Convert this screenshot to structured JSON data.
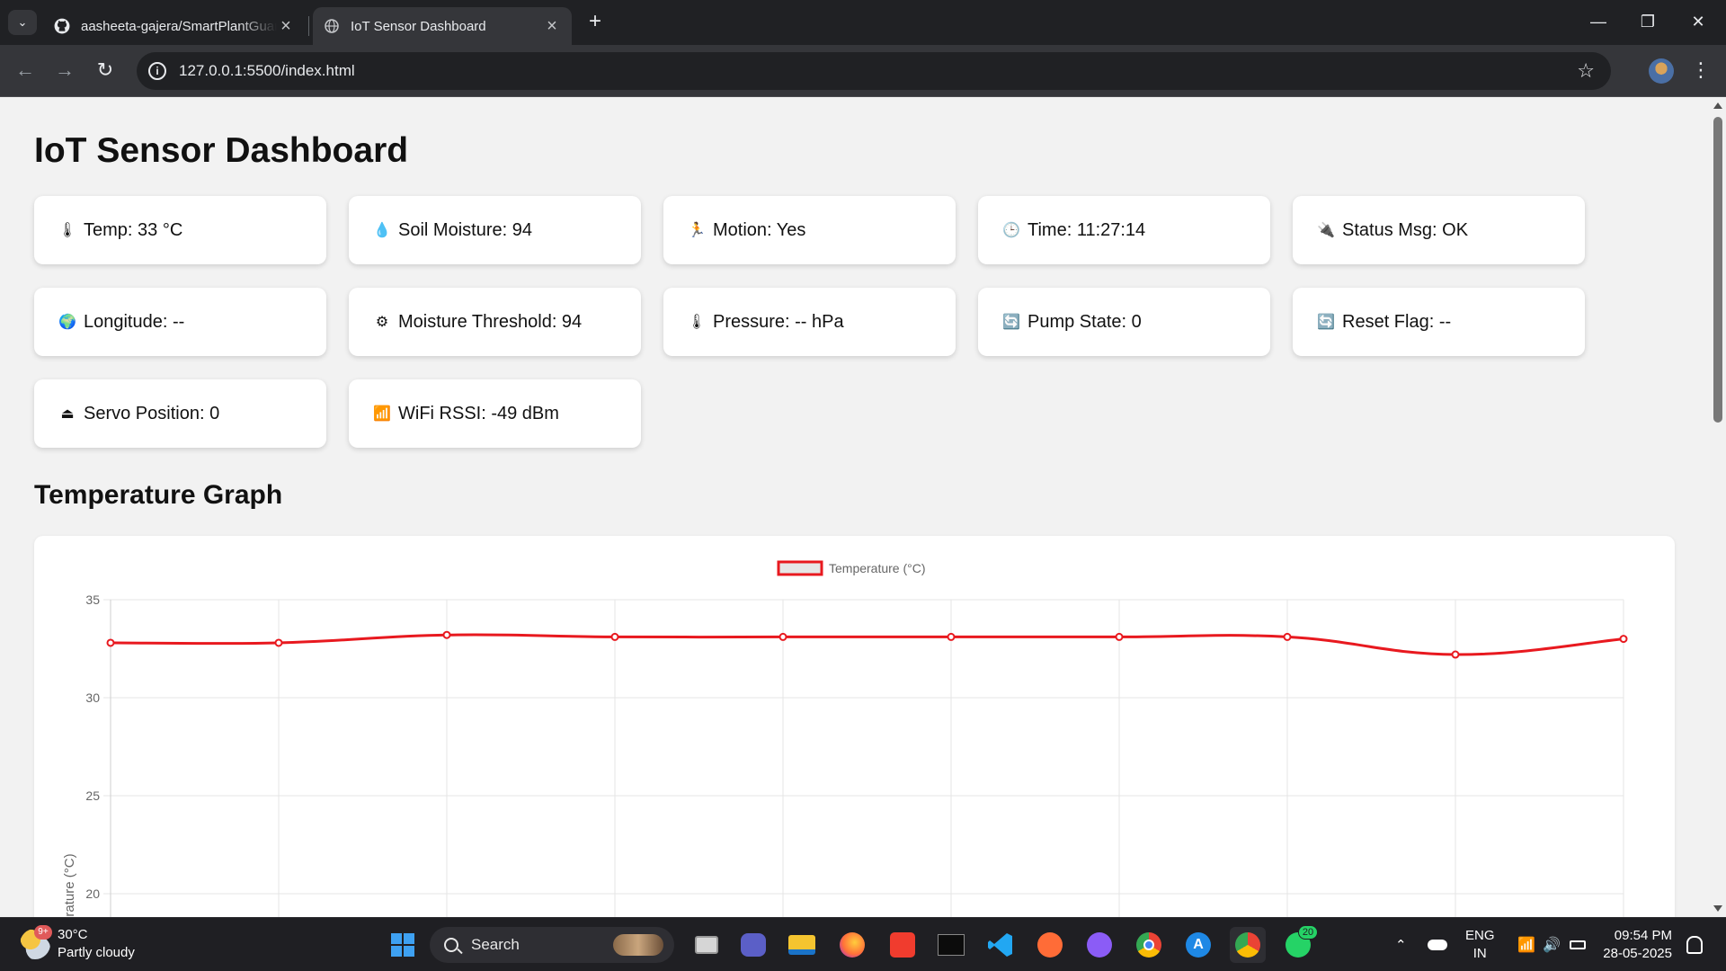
{
  "browser": {
    "tabs": [
      {
        "title": "aasheeta-gajera/SmartPlantGuard",
        "favicon": "github-icon",
        "active": false
      },
      {
        "title": "IoT Sensor Dashboard",
        "favicon": "globe-icon",
        "active": true
      }
    ],
    "url": "127.0.0.1:5500/index.html"
  },
  "page": {
    "title": "IoT Sensor Dashboard",
    "cards": [
      {
        "icon": "thermometer-icon",
        "glyph": "🌡",
        "label": "Temp: 33 °C"
      },
      {
        "icon": "droplet-icon",
        "glyph": "💧",
        "label": "Soil Moisture: 94"
      },
      {
        "icon": "running-person-icon",
        "glyph": "🏃",
        "label": "Motion: Yes"
      },
      {
        "icon": "clock-icon",
        "glyph": "🕒",
        "label": "Time: 11:27:14"
      },
      {
        "icon": "plug-icon",
        "glyph": "🔌",
        "label": "Status Msg: OK"
      },
      {
        "icon": "globe-icon",
        "glyph": "🌍",
        "label": "Longitude: --"
      },
      {
        "icon": "gear-icon",
        "glyph": "⚙",
        "label": "Moisture Threshold: 94"
      },
      {
        "icon": "thermometer-icon",
        "glyph": "🌡",
        "label": "Pressure: -- hPa"
      },
      {
        "icon": "refresh-icon",
        "glyph": "🔄",
        "label": "Pump State: 0"
      },
      {
        "icon": "reset-icon",
        "glyph": "🔄",
        "label": "Reset Flag: --"
      },
      {
        "icon": "servo-icon",
        "glyph": "⏏",
        "label": "Servo Position: 0"
      },
      {
        "icon": "signal-bars-icon",
        "glyph": "📶",
        "label": "WiFi RSSI: -49 dBm"
      }
    ],
    "graph_title": "Temperature Graph"
  },
  "chart_data": {
    "type": "line",
    "series": [
      {
        "name": "Temperature (°C)",
        "values": [
          32.8,
          32.8,
          33.2,
          33.1,
          33.1,
          33.1,
          33.1,
          33.1,
          32.2,
          33.0
        ]
      }
    ],
    "yticks": [
      35,
      30,
      25,
      20
    ],
    "ylim": [
      20,
      35
    ],
    "ylabel": "Temperature (°C)",
    "line_color": "#e8191f",
    "legend": "top"
  },
  "taskbar": {
    "weather": {
      "temp": "30°C",
      "desc": "Partly cloudy",
      "badge": "9+"
    },
    "search_label": "Search",
    "whatsapp_badge": "20",
    "lang": {
      "line1": "ENG",
      "line2": "IN"
    },
    "clock": {
      "time": "09:54 PM",
      "date": "28-05-2025"
    }
  }
}
